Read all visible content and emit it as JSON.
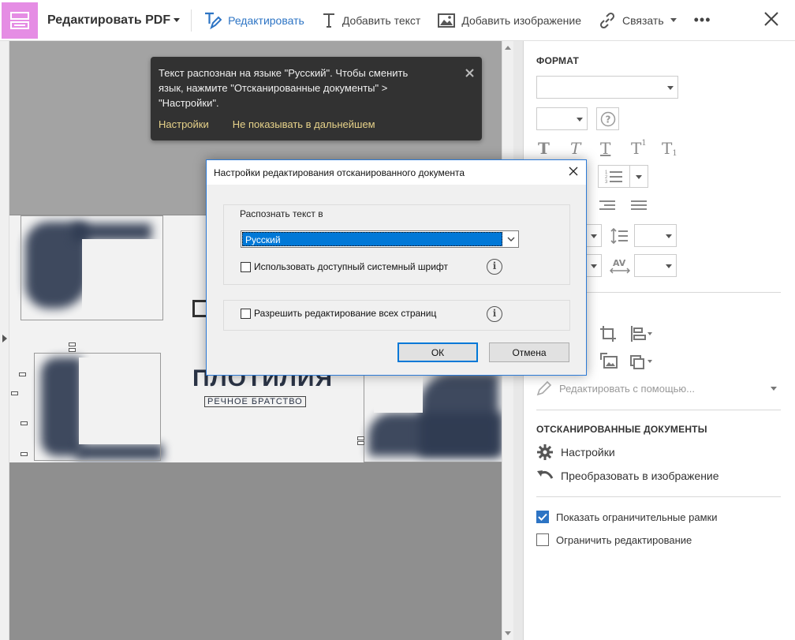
{
  "toolbar": {
    "title": "Редактировать PDF",
    "edit_label": "Редактировать",
    "add_text_label": "Добавить текст",
    "add_image_label": "Добавить изображение",
    "link_label": "Связать",
    "more_label": "•••"
  },
  "toast": {
    "message": "Текст распознан на языке \"Русский\". Чтобы сменить язык, нажмите \"Отсканированные документы\" > \"Настройки\".",
    "settings_link": "Настройки",
    "dont_show_link": "Не показывать в дальнейшем"
  },
  "dialog": {
    "title": "Настройки редактирования отсканированного документа",
    "recognize_label": "Распознать текст в",
    "language_value": "Русский",
    "use_system_font_label": "Использовать доступный системный шрифт",
    "allow_all_pages_label": "Разрешить редактирование всех страниц",
    "ok_label": "ОК",
    "cancel_label": "Отмена"
  },
  "page": {
    "big_text": "ПЛОТИЛИЯ",
    "small_text": "РЕЧНОЕ БРАТСТВО"
  },
  "panel": {
    "format_title": "ФОРМАТ",
    "edit_with_label": "Редактировать с помощью...",
    "scanned_title": "ОТСКАНИРОВАННЫЕ ДОКУМЕНТЫ",
    "settings_label": "Настройки",
    "convert_label": "Преобразовать в изображение",
    "show_bounds_label": "Показать ограничительные рамки",
    "show_bounds_checked": true,
    "restrict_label": "Ограничить редактирование",
    "restrict_checked": false
  },
  "colors": {
    "accent": "#2d74c4",
    "tool_tile": "#e58de4",
    "toast_bg": "#323232",
    "toast_link": "#e8d38a",
    "selection": "#0078d7"
  }
}
